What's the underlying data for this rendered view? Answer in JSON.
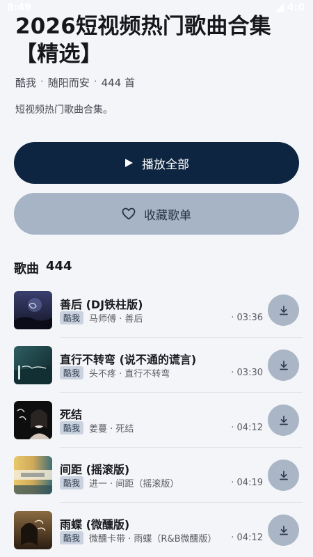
{
  "status": {
    "time": "8:49",
    "battery": "4:0"
  },
  "playlist": {
    "title": "2026短视频热门歌曲合集【精选】",
    "source": "酷我",
    "author": "随阳而安",
    "count": "444 首",
    "description": "短视频热门歌曲合集。"
  },
  "actions": {
    "play_all": "播放全部",
    "favorite": "收藏歌单"
  },
  "section": {
    "label": "歌曲",
    "count": "444"
  },
  "songs": [
    {
      "title": "善后 (DJ铁柱版)",
      "tag": "酷我",
      "meta": "马师傅 · 善后",
      "duration": "· 03:36"
    },
    {
      "title": "直行不转弯 (说不通的谎言)",
      "tag": "酷我",
      "meta": "头不疼 · 直行不转弯",
      "duration": "· 03:30"
    },
    {
      "title": "死结",
      "tag": "酷我",
      "meta": "姜蔓 · 死结",
      "duration": "· 04:12"
    },
    {
      "title": "间距 (摇滚版)",
      "tag": "酷我",
      "meta": "进一 · 间距（摇滚版）",
      "duration": "· 04:19"
    },
    {
      "title": "雨蝶 (微醺版)",
      "tag": "酷我",
      "meta": "微醺卡带 · 雨蝶（R&B微醺版）",
      "duration": "· 04:12"
    }
  ],
  "colors": {
    "play_button": "#0d2540",
    "favorite_button": "#a7b4c6",
    "tag_bg": "#c9d2de",
    "download_bg": "#aab6c6"
  }
}
